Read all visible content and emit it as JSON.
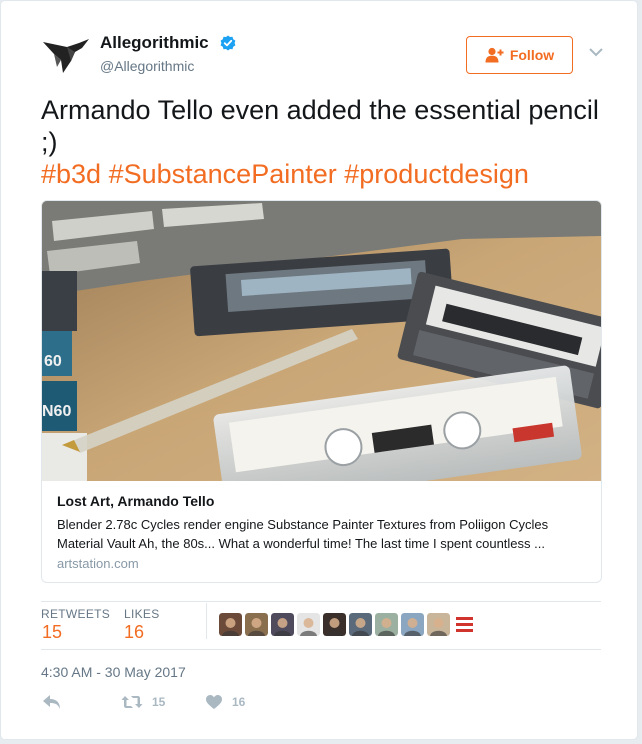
{
  "author": {
    "name": "Allegorithmic",
    "handle": "@Allegorithmic",
    "verified": true,
    "avatar_icon": "hummingbird-logo-icon"
  },
  "follow_button": {
    "label": "Follow",
    "icon": "add-user-icon"
  },
  "menu_icon": "chevron-down-icon",
  "tweet": {
    "text": "Armando Tello even added the essential pencil ;)",
    "hashtags": [
      "#b3d",
      "#SubstancePainter",
      "#productdesign"
    ]
  },
  "link_card": {
    "image": "cassette-tapes-render",
    "title": "Lost Art, Armando Tello",
    "description": "Blender 2.78c Cycles render engine Substance Painter Textures from Poliigon Cycles Material Vault Ah, the 80s... What a wonderful time! The last time I spent countless ...",
    "domain": "artstation.com"
  },
  "stats": {
    "retweets_label": "RETWEETS",
    "retweets": "15",
    "likes_label": "LIKES",
    "likes": "16",
    "liker_avatars": 10
  },
  "timestamp": "4:30 AM - 30 May 2017",
  "actions": {
    "reply_icon": "reply-icon",
    "retweet_icon": "retweet-icon",
    "retweet_count": "15",
    "like_icon": "heart-icon",
    "like_count": "16"
  },
  "colors": {
    "accent": "#f26c22",
    "muted": "#657786",
    "verified": "#1da1f2",
    "border": "#e1e8ed"
  }
}
